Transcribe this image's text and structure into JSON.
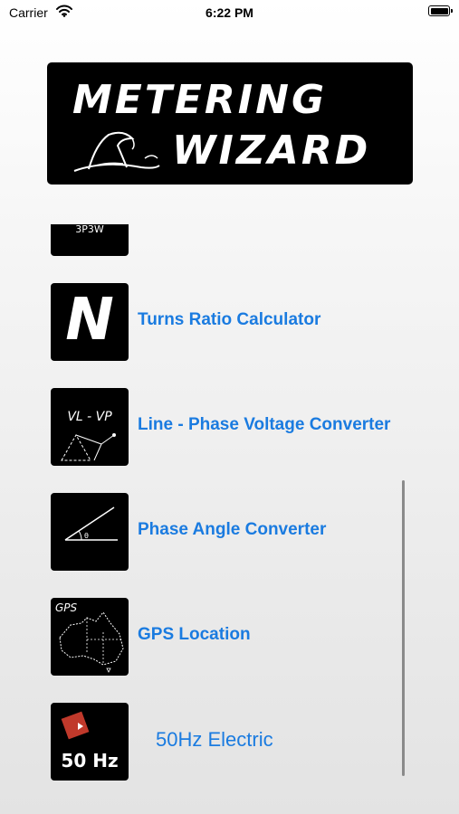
{
  "status_bar": {
    "carrier": "Carrier",
    "time": "6:22 PM"
  },
  "logo": {
    "line1": "METERING",
    "line2": "WIZARD"
  },
  "list": {
    "partial_item_label": "3P3W",
    "items": [
      {
        "label": "Turns Ratio Calculator",
        "thumb_text": "N",
        "icon": "turns-ratio-icon"
      },
      {
        "label": "Line - Phase Voltage Converter",
        "thumb_text": "VL - VP",
        "icon": "voltage-triangle-icon"
      },
      {
        "label": "Phase Angle Converter",
        "icon": "angle-icon"
      },
      {
        "label": "GPS Location",
        "thumb_text": "GPS",
        "icon": "australia-map-icon"
      },
      {
        "label": "50Hz Electric",
        "thumb_text": "50 Hz",
        "icon": "50hz-logo-icon"
      }
    ]
  },
  "colors": {
    "link_blue": "#1a7be0",
    "thumb_bg": "#000000",
    "hz_diamond": "#c0392b"
  }
}
